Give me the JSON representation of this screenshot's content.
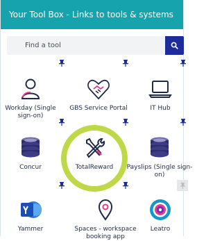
{
  "header": {
    "title": "Your Tool Box - Links to tools & systems"
  },
  "search": {
    "placeholder": "Find a tool",
    "button_icon": "search-icon"
  },
  "colors": {
    "header_bg": "#16a3ad",
    "search_button_bg": "#1c2c9a",
    "highlight_ring": "#b8d433",
    "pin": "#1c2c9a"
  },
  "tools": [
    {
      "label": "Workday (Single sign-on)",
      "icon": "person-icon",
      "pinned": true
    },
    {
      "label": "GBS Service Portal",
      "icon": "heart-handshake-icon",
      "pinned": true
    },
    {
      "label": "IT Hub",
      "icon": "laptop-icon",
      "pinned": true
    },
    {
      "label": "Concur",
      "icon": "coin-stack-icon",
      "pinned": true
    },
    {
      "label": "TotalReward",
      "icon": "tools-icon",
      "pinned": true,
      "highlighted": true
    },
    {
      "label": "Payslips (Single sign-on)",
      "icon": "coin-stack-icon",
      "pinned": true
    },
    {
      "label": "Yammer",
      "icon": "yammer-icon",
      "pinned": true
    },
    {
      "label": "Spaces - workspace booking app",
      "icon": "location-pin-icon",
      "pinned": true
    },
    {
      "label": "Leatro",
      "icon": "leatro-icon",
      "pinned": false
    }
  ]
}
